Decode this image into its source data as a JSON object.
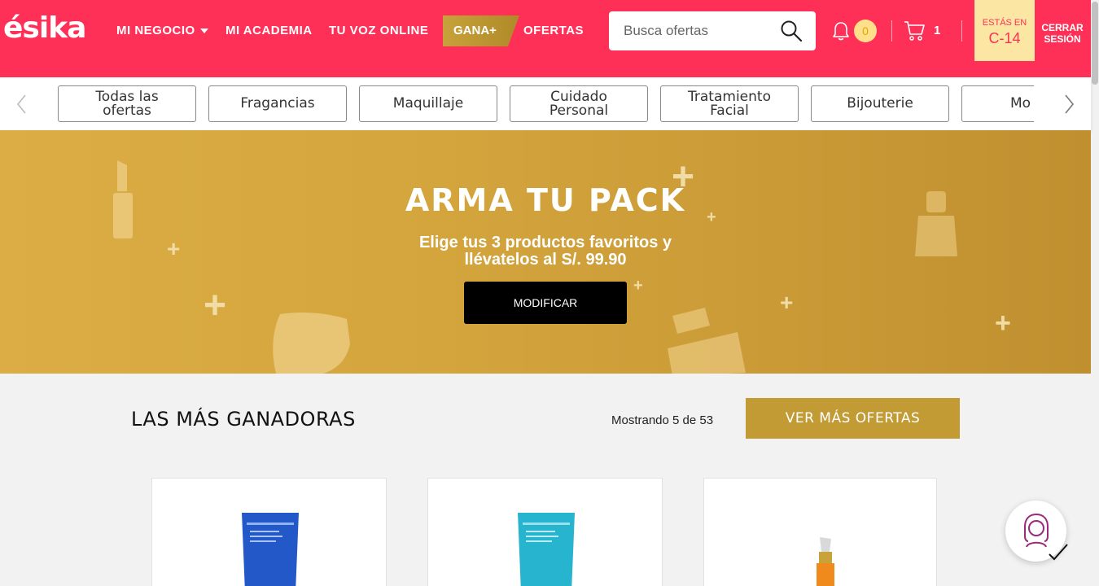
{
  "header": {
    "logo": "ésika",
    "nav": {
      "mi_negocio": "MI NEGOCIO",
      "mi_academia": "MI ACADEMIA",
      "tu_voz": "TU VOZ ONLINE",
      "gana": "GANA+",
      "ofertas": "OFERTAS"
    },
    "search_placeholder": "Busca ofertas",
    "notifications_count": "0",
    "cart_count": "1",
    "campaign_label": "ESTÁS EN",
    "campaign_value": "C-14",
    "logout_line1": "CERRAR",
    "logout_line2": "SESIÓN",
    "colors": {
      "primary": "#ff3057",
      "gold": "#c29b35"
    }
  },
  "categories": [
    {
      "line1": "Todas las",
      "line2": "ofertas"
    },
    {
      "line1": "Fragancias",
      "line2": ""
    },
    {
      "line1": "Maquillaje",
      "line2": ""
    },
    {
      "line1": "Cuidado",
      "line2": "Personal"
    },
    {
      "line1": "Tratamiento",
      "line2": "Facial"
    },
    {
      "line1": "Bijouterie",
      "line2": ""
    },
    {
      "line1": "Mo",
      "line2": ""
    }
  ],
  "banner": {
    "title": "ARMA TU PACK",
    "subtitle_line1": "Elige tus 3 productos favoritos y",
    "subtitle_line2": "llévatelos al S/. 99.90",
    "button": "MODIFICAR"
  },
  "section": {
    "title": "LAS MÁS GANADORAS",
    "showing": "Mostrando 5 de 53",
    "more_button": "VER MÁS OFERTAS"
  }
}
